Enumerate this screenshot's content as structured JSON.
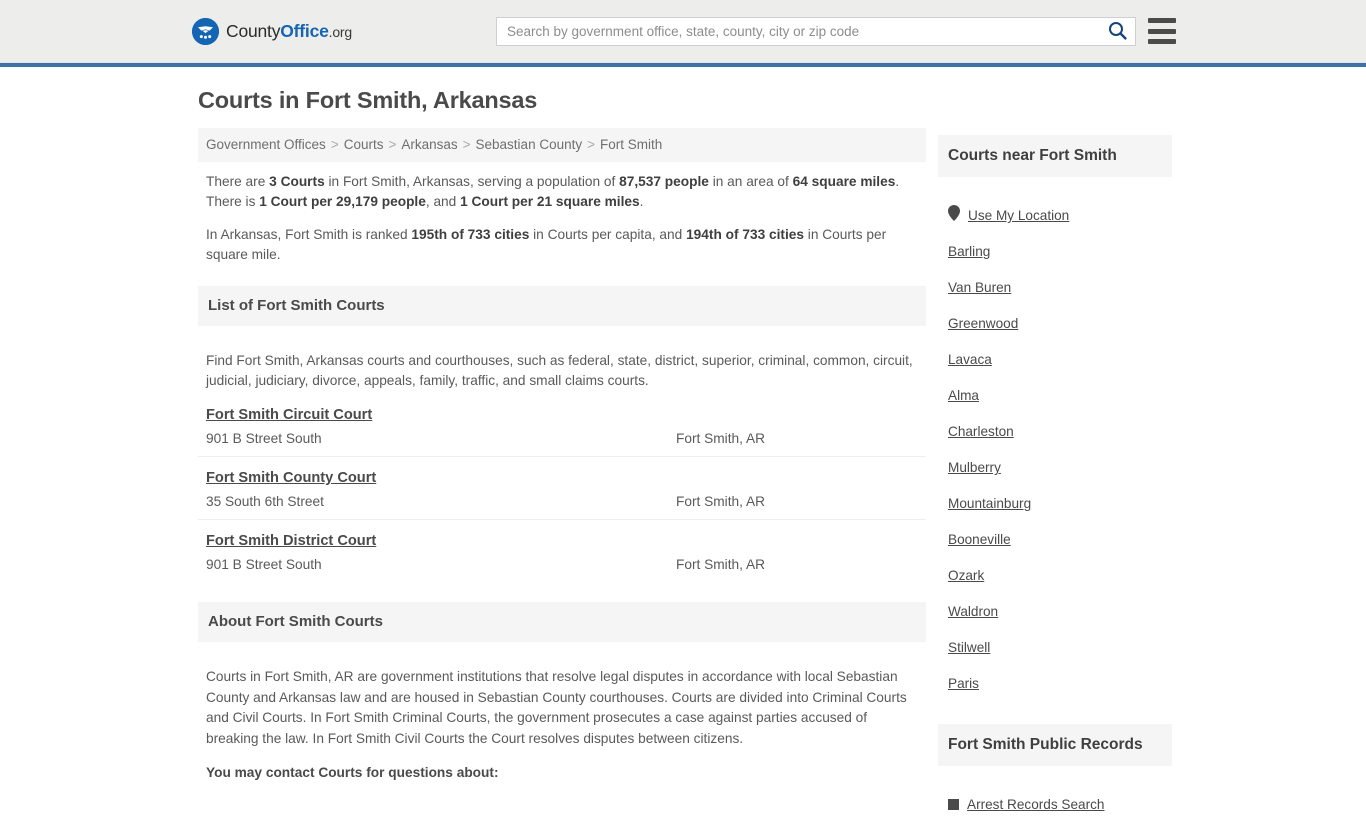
{
  "header": {
    "logo": {
      "icon": "eagle-shield-icon",
      "text_part1": "County",
      "text_part2": "Office",
      "text_part3": ".org"
    },
    "search": {
      "placeholder": "Search by government office, state, county, city or zip code",
      "value": "",
      "icon": "search-icon"
    },
    "menu": {
      "icon": "hamburger-menu-icon",
      "label": "Menu"
    },
    "accent_color": "#3b73a8",
    "background_color": "#ededeb"
  },
  "main": {
    "page_title": "Courts in Fort Smith, Arkansas",
    "breadcrumb": [
      "Government Offices",
      "Courts",
      "Arkansas",
      "Sebastian County",
      "Fort Smith"
    ],
    "breadcrumb_separator": ">",
    "stats": {
      "line1_a": "There are ",
      "line1_b": "3 Courts",
      "line1_c": " in Fort Smith, Arkansas, serving a population of ",
      "line1_d": "87,537 people",
      "line1_e": " in an area of ",
      "line1_f": "64 square miles",
      "line1_g": ". There is ",
      "line1_h": "1 Court per 29,179 people",
      "line1_i": ", and ",
      "line1_j": "1 Court per 21 square miles",
      "line1_k": ".",
      "line2_a": "In Arkansas, Fort Smith is ranked ",
      "line2_b": "195th of 733 cities",
      "line2_c": " in Courts per capita, and ",
      "line2_d": "194th of 733 cities",
      "line2_e": " in Courts per square mile."
    },
    "list_section": {
      "heading": "List of Fort Smith Courts",
      "intro": "Find Fort Smith, Arkansas courts and courthouses, such as federal, state, district, superior, criminal, common, circuit, judicial, judiciary, divorce, appeals, family, traffic, and small claims courts.",
      "courts": [
        {
          "name": "Fort Smith Circuit Court",
          "address": "901 B Street South",
          "city": "Fort Smith, AR"
        },
        {
          "name": "Fort Smith County Court",
          "address": "35 South 6th Street",
          "city": "Fort Smith, AR"
        },
        {
          "name": "Fort Smith District Court",
          "address": "901 B Street South",
          "city": "Fort Smith, AR"
        }
      ]
    },
    "about_section": {
      "heading": "About Fort Smith Courts",
      "body": "Courts in Fort Smith, AR are government institutions that resolve legal disputes in accordance with local Sebastian County and Arkansas law and are housed in Sebastian County courthouses. Courts are divided into Criminal Courts and Civil Courts. In Fort Smith Criminal Courts, the government prosecutes a case against parties accused of breaking the law. In Fort Smith Civil Courts the Court resolves disputes between citizens.",
      "contact_heading": "You may contact Courts for questions about:"
    }
  },
  "sidebar": {
    "nearby": {
      "heading": "Courts near Fort Smith",
      "use_my_location": {
        "label": "Use My Location",
        "icon": "map-pin-icon"
      },
      "cities": [
        "Barling",
        "Van Buren",
        "Greenwood",
        "Lavaca",
        "Alma",
        "Charleston",
        "Mulberry",
        "Mountainburg",
        "Booneville",
        "Ozark",
        "Waldron",
        "Stilwell",
        "Paris"
      ]
    },
    "public_records": {
      "heading": "Fort Smith Public Records",
      "links": [
        {
          "label": "Arrest Records Search",
          "icon": "square-bullet-icon"
        }
      ]
    }
  }
}
